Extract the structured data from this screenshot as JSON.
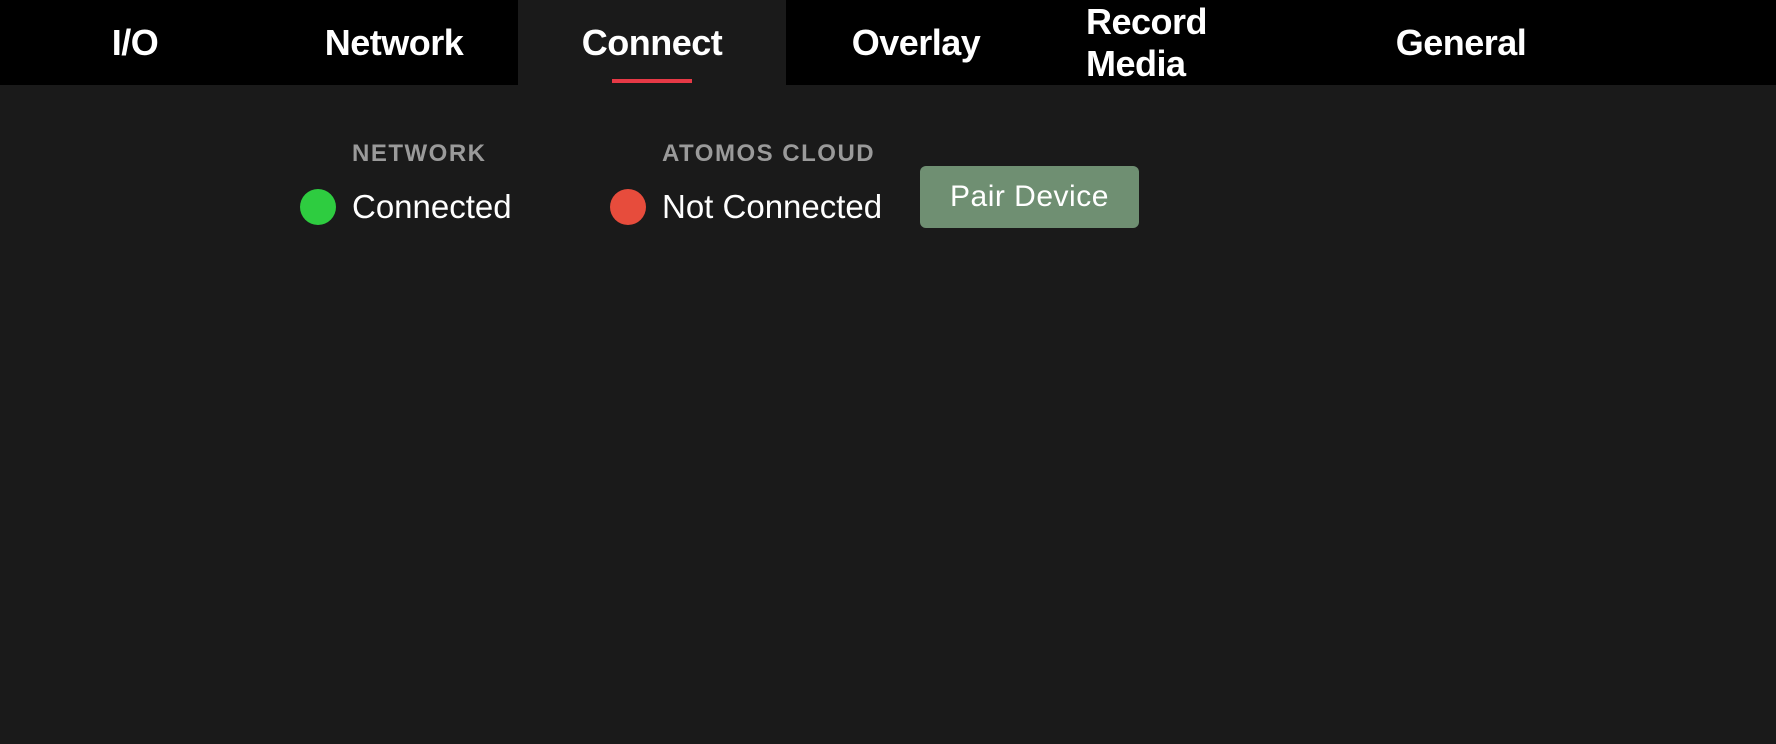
{
  "tabs": {
    "io": "I/O",
    "network": "Network",
    "connect": "Connect",
    "overlay": "Overlay",
    "record_media": "Record Media",
    "general": "General"
  },
  "status": {
    "network": {
      "label": "NETWORK",
      "value": "Connected",
      "color": "green"
    },
    "cloud": {
      "label": "ATOMOS CLOUD",
      "value": "Not Connected",
      "color": "red"
    }
  },
  "buttons": {
    "pair_device": "Pair Device"
  }
}
